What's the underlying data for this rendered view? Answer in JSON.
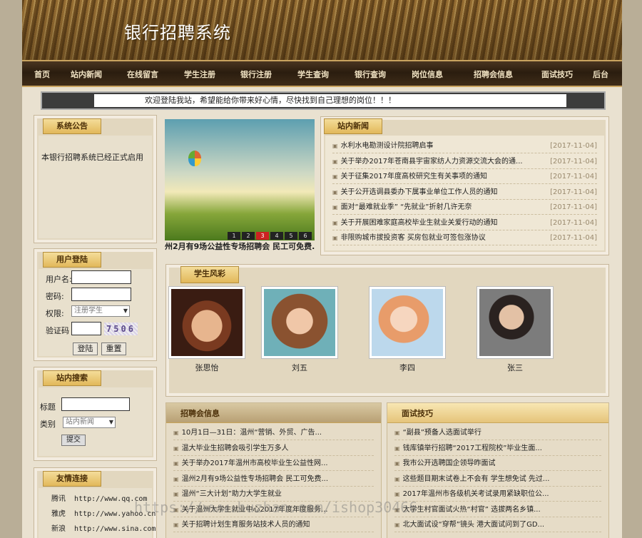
{
  "site": {
    "title": "银行招聘系统"
  },
  "nav": [
    "首页",
    "站内新闻",
    "在线留言",
    "学生注册",
    "银行注册",
    "学生查询",
    "银行查询",
    "岗位信息",
    "招聘会信息",
    "面试技巧",
    "后台"
  ],
  "marquee": "欢迎登陆我站，希望能给你带来好心情，尽快找到自己理想的岗位！！！",
  "notice": {
    "title": "系统公告",
    "text": "本银行招聘系统已经正式启用"
  },
  "login": {
    "title": "用户登陆",
    "username_label": "用户名:",
    "password_label": "密码:",
    "role_label": "权限:",
    "role_value": "注册学生",
    "captcha_label": "验证码",
    "captcha_code": "7506",
    "login_button": "登陆",
    "reset_button": "重置"
  },
  "search": {
    "title": "站内搜索",
    "title_label": "标题",
    "category_label": "类别",
    "category_value": "站内新闻",
    "submit_button": "提交"
  },
  "links": {
    "title": "友情连接",
    "items": [
      {
        "name": "腾讯",
        "url": "http://www.qq.com"
      },
      {
        "name": "雅虎",
        "url": "http://www.yahoo.cn"
      },
      {
        "name": "新浪",
        "url": "http://www.sina.com"
      }
    ]
  },
  "slideshow": {
    "caption": "州2月有9场公益性专场招聘会 民工可免费...",
    "pages": [
      "1",
      "2",
      "3",
      "4",
      "5",
      "6"
    ],
    "active_page": "3"
  },
  "news": {
    "title": "站内新闻",
    "items": [
      {
        "title": "水利水电勘测设计院招聘启事",
        "date": "[2017-11-04]"
      },
      {
        "title": "关于举办2017年苍南县宇宙家纺人力资源交流大会的通...",
        "date": "[2017-11-04]"
      },
      {
        "title": "关于征集2017年度高校研究生有关事项的通知",
        "date": "[2017-11-04]"
      },
      {
        "title": "关于公开选调县委办下属事业单位工作人员的通知",
        "date": "[2017-11-04]"
      },
      {
        "title": "面对“最难就业季” “先就业”折射几许无奈",
        "date": "[2017-11-04]"
      },
      {
        "title": "关于开展困难家庭高校毕业生就业关爱行动的通知",
        "date": "[2017-11-04]"
      },
      {
        "title": "非限购城市拔投资客 买房包就业可签包涨协议",
        "date": "[2017-11-04]"
      }
    ]
  },
  "students": {
    "title": "学生风彩",
    "items": [
      {
        "name": "张思怡"
      },
      {
        "name": "刘五"
      },
      {
        "name": "李四"
      },
      {
        "name": "张三"
      }
    ]
  },
  "job_fairs": {
    "title": "招聘会信息",
    "items": [
      "10月1日—31日：温州“营销、外贸、广告...",
      "温大毕业生招聘会吸引学生万多人",
      "关于举办2017年温州市高校毕业生公益性网...",
      "温州2月有9场公益性专场招聘会 民工可免费...",
      "温州“三大计划”助力大学生就业",
      "关于温州大学生就业中心2017年度年度服务...",
      "关于招聘计划生育服务站技术人员的通知"
    ]
  },
  "tips": {
    "title": "面试技巧",
    "items": [
      "“副县”预备人选面试举行",
      "钱库镇举行招聘“2017工程院校”毕业生面...",
      "我市公开选聘国企领导昨面试",
      "这些题目期末试卷上不会有 学生想免试 先过...",
      "2017年温州市各级机关考试录用紧缺职位公...",
      "大学生村官面试火热“村官” 选拔两名乡镇...",
      "北大面试设“穿帮”镜头 港大面试问到了GD..."
    ]
  },
  "watermark": "https://www.huzhan.com/ishop30466"
}
